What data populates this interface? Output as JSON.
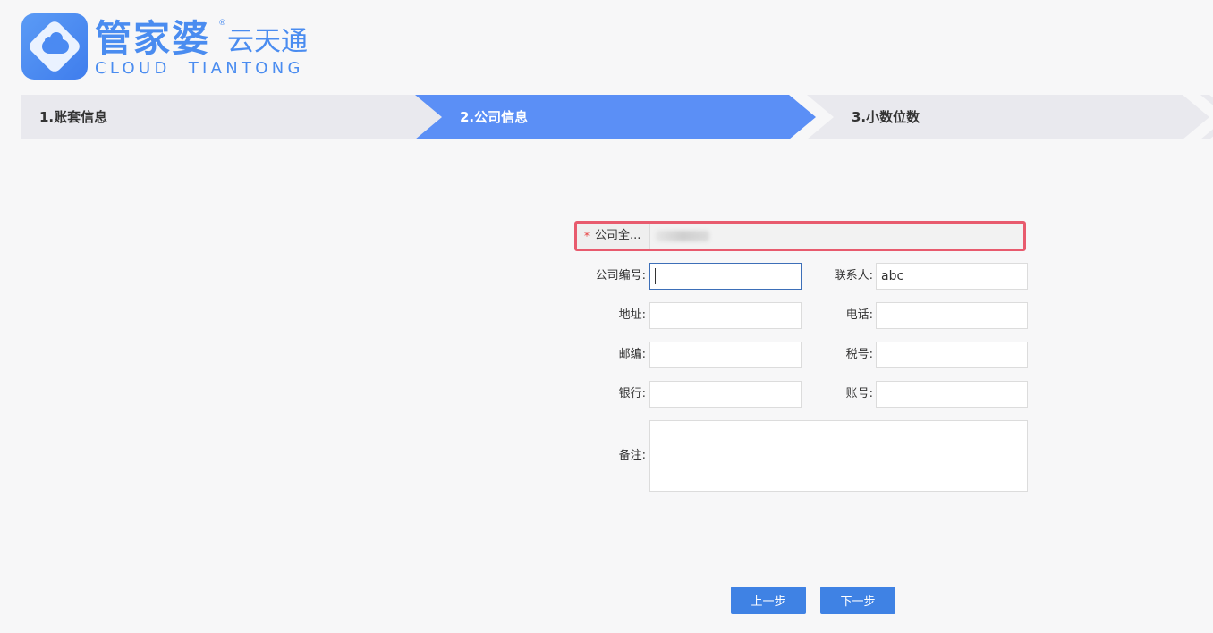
{
  "brand": {
    "name_cn": "管家婆",
    "registered_mark": "®",
    "product_cn": "云天通",
    "name_en": "CLOUD  TIANTONG"
  },
  "steps": [
    {
      "label": "1.账套信息",
      "active": false
    },
    {
      "label": "2.公司信息",
      "active": true
    },
    {
      "label": "3.小数位数",
      "active": false
    }
  ],
  "form": {
    "company_full_name": {
      "required_mark": "*",
      "label": "公司全...",
      "value": ""
    },
    "company_code": {
      "label": "公司编号:",
      "value": ""
    },
    "contact": {
      "label": "联系人:",
      "value": "abc"
    },
    "address": {
      "label": "地址:",
      "value": ""
    },
    "phone": {
      "label": "电话:",
      "value": ""
    },
    "postcode": {
      "label": "邮编:",
      "value": ""
    },
    "tax_no": {
      "label": "税号:",
      "value": ""
    },
    "bank": {
      "label": "银行:",
      "value": ""
    },
    "account_no": {
      "label": "账号:",
      "value": ""
    },
    "remark": {
      "label": "备注:",
      "value": ""
    }
  },
  "buttons": {
    "prev_label": "上一步",
    "next_label": "下一步"
  },
  "colors": {
    "accent": "#5b8ff6",
    "button": "#3f82e4",
    "highlight_border": "#e85b6e",
    "brand": "#4a8cf0"
  }
}
